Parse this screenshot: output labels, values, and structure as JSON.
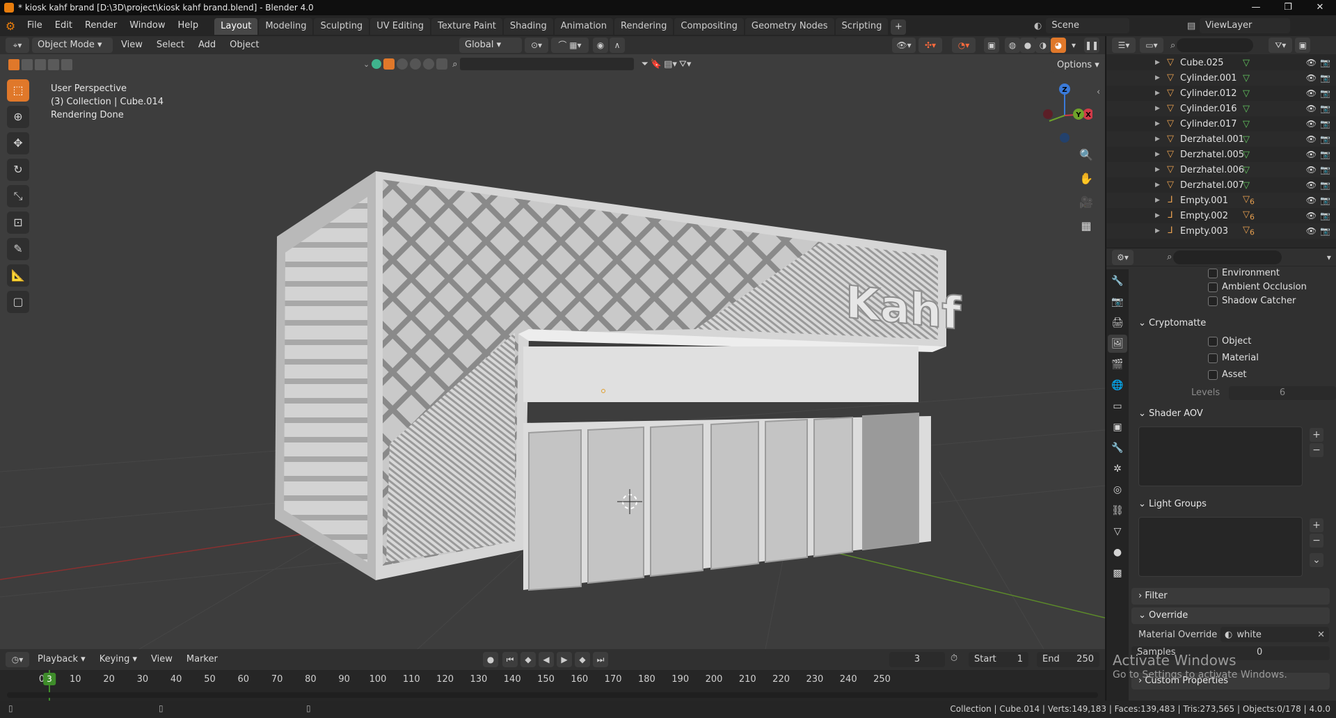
{
  "window": {
    "title": "* kiosk kahf brand [D:\\3D\\project\\kiosk kahf brand.blend] - Blender 4.0",
    "controls": [
      "—",
      "❐",
      "✕"
    ]
  },
  "menubar": {
    "menus": [
      "File",
      "Edit",
      "Render",
      "Window",
      "Help"
    ],
    "workspaces": [
      "Layout",
      "Modeling",
      "Sculpting",
      "UV Editing",
      "Texture Paint",
      "Shading",
      "Animation",
      "Rendering",
      "Compositing",
      "Geometry Nodes",
      "Scripting"
    ],
    "active_workspace": "Layout",
    "add_workspace": "+",
    "scene": "Scene",
    "view_layer": "ViewLayer"
  },
  "viewport_header": {
    "mode": "Object Mode",
    "menus": [
      "View",
      "Select",
      "Add",
      "Object"
    ],
    "transform_orientation": "Global",
    "options_label": "Options"
  },
  "viewport_overlay_text": {
    "line1": "User Perspective",
    "line2": "(3) Collection | Cube.014",
    "line3": "Rendering Done"
  },
  "model": {
    "sign_text": "Kahf"
  },
  "gizmo": {
    "z_label": "Z",
    "y_label": "Y",
    "x_label": "X"
  },
  "outliner": {
    "items": [
      {
        "name": "Cube.025",
        "type": "mesh"
      },
      {
        "name": "Cylinder.001",
        "type": "mesh"
      },
      {
        "name": "Cylinder.012",
        "type": "mesh"
      },
      {
        "name": "Cylinder.016",
        "type": "mesh"
      },
      {
        "name": "Cylinder.017",
        "type": "mesh"
      },
      {
        "name": "Derzhatel.001",
        "type": "mesh"
      },
      {
        "name": "Derzhatel.005",
        "type": "mesh"
      },
      {
        "name": "Derzhatel.006",
        "type": "mesh"
      },
      {
        "name": "Derzhatel.007",
        "type": "mesh"
      },
      {
        "name": "Empty.001",
        "type": "empty"
      },
      {
        "name": "Empty.002",
        "type": "empty"
      },
      {
        "name": "Empty.003",
        "type": "empty"
      }
    ],
    "empty_child_count": "6"
  },
  "properties": {
    "passes_light": [
      "Environment",
      "Ambient Occlusion",
      "Shadow Catcher"
    ],
    "cryptomatte_title": "Cryptomatte",
    "cryptomatte": [
      "Object",
      "Material",
      "Asset"
    ],
    "levels_label": "Levels",
    "levels_value": "6",
    "shader_aov_title": "Shader AOV",
    "light_groups_title": "Light Groups",
    "filter_title": "Filter",
    "override_title": "Override",
    "material_override_label": "Material Override",
    "material_override_value": "white",
    "samples_label": "Samples",
    "samples_value": "0",
    "custom_props_title": "Custom Properties"
  },
  "timeline": {
    "menus": [
      "Playback",
      "Keying",
      "View",
      "Marker"
    ],
    "current_frame": "3",
    "start_label": "Start",
    "start_value": "1",
    "end_label": "End",
    "end_value": "250",
    "ticks": [
      "0",
      "10",
      "20",
      "30",
      "40",
      "50",
      "60",
      "70",
      "80",
      "90",
      "100",
      "110",
      "120",
      "130",
      "140",
      "150",
      "160",
      "170",
      "180",
      "190",
      "200",
      "210",
      "220",
      "230",
      "240",
      "250"
    ]
  },
  "statusbar": {
    "text": "Collection | Cube.014 | Verts:149,183 | Faces:139,483 | Tris:273,565 | Objects:0/178 | 4.0.0"
  },
  "watermark": {
    "line1": "Activate Windows",
    "line2": "Go to Settings to activate Windows."
  },
  "colors": {
    "accent": "#e0782a",
    "frame_green": "#3e8d2a",
    "viewport_bg": "#3d3d3d",
    "mesh_data_green": "#62c55f"
  }
}
